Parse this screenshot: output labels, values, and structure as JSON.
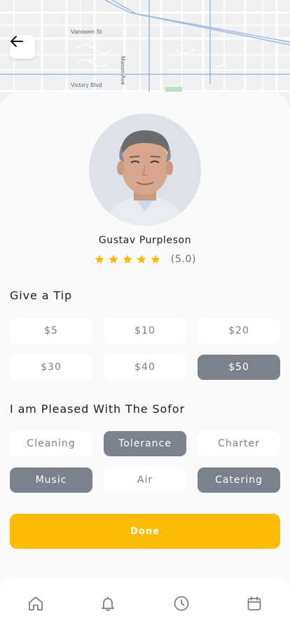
{
  "map": {
    "streets": [
      "Vanowen St",
      "Victory Blvd",
      "Mason Ave"
    ]
  },
  "driver": {
    "name": "Gustav Purpleson",
    "rating_value": 5.0,
    "rating_text": "(5.0)",
    "stars": 5
  },
  "tip": {
    "title": "Give a Tip",
    "options": [
      {
        "label": "$5",
        "selected": false
      },
      {
        "label": "$10",
        "selected": false
      },
      {
        "label": "$20",
        "selected": false
      },
      {
        "label": "$30",
        "selected": false
      },
      {
        "label": "$40",
        "selected": false
      },
      {
        "label": "$50",
        "selected": true
      }
    ]
  },
  "pleased": {
    "title": "I am Pleased With The Sofor",
    "options": [
      {
        "label": "Cleaning",
        "selected": false
      },
      {
        "label": "Tolerance",
        "selected": true
      },
      {
        "label": "Charter",
        "selected": false
      },
      {
        "label": "Music",
        "selected": true
      },
      {
        "label": "Air",
        "selected": false
      },
      {
        "label": "Catering",
        "selected": true
      }
    ]
  },
  "done_label": "Done",
  "colors": {
    "accent": "#fbbc05",
    "chip_selected": "#7b828d",
    "chip_default": "#ffffff",
    "star": "#fbbc05"
  },
  "icons": {
    "back": "arrow-left-icon",
    "nav": [
      "home-icon",
      "bell-icon",
      "clock-icon",
      "calendar-icon"
    ]
  }
}
